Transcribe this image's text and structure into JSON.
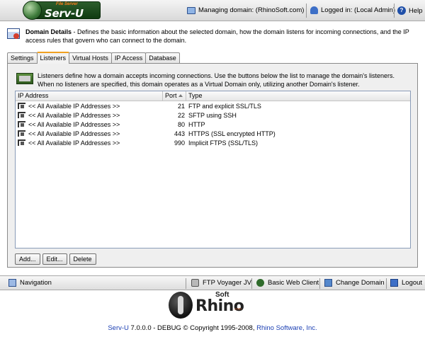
{
  "header": {
    "logo_text": "Serv-U",
    "logo_sub": "File Server",
    "managing_domain": "Managing domain: (RhinoSoft.com)",
    "logged_in": "Logged in: (Local Admin)",
    "help": "Help"
  },
  "description": {
    "title": "Domain Details",
    "text": " - Defines the basic information about the selected domain, how the domain listens for incoming connections, and the IP access rules that govern who can connect to the domain."
  },
  "tabs": [
    {
      "label": "Settings",
      "active": false
    },
    {
      "label": "Listeners",
      "active": true
    },
    {
      "label": "Virtual Hosts",
      "active": false
    },
    {
      "label": "IP Access",
      "active": false
    },
    {
      "label": "Database",
      "active": false
    }
  ],
  "panel": {
    "description": "Listeners define how a domain accepts incoming connections. Use the buttons below the list to manage the domain's listeners. When no listeners are specified, this domain operates as a Virtual Domain only, utilizing another Domain's listener."
  },
  "table": {
    "columns": [
      "IP Address",
      "Port",
      "Type"
    ],
    "rows": [
      {
        "ip": "<< All Available IP Addresses >>",
        "port": "21",
        "type": "FTP and explicit SSL/TLS"
      },
      {
        "ip": "<< All Available IP Addresses >>",
        "port": "22",
        "type": "SFTP using SSH"
      },
      {
        "ip": "<< All Available IP Addresses >>",
        "port": "80",
        "type": "HTTP"
      },
      {
        "ip": "<< All Available IP Addresses >>",
        "port": "443",
        "type": "HTTPS (SSL encrypted HTTP)"
      },
      {
        "ip": "<< All Available IP Addresses >>",
        "port": "990",
        "type": "Implicit FTPS (SSL/TLS)"
      }
    ]
  },
  "buttons": {
    "add": "Add...",
    "edit": "Edit...",
    "delete": "Delete"
  },
  "navbar": {
    "navigation": "Navigation",
    "ftp_voyager": "FTP Voyager JV",
    "basic_web_client": "Basic Web Client",
    "change_domain": "Change Domain",
    "logout": "Logout"
  },
  "footer": {
    "logo_text": "Rhino",
    "logo_soft": "Soft",
    "logo_com": ".com",
    "product": "Serv-U",
    "version_text": " 7.0.0.0 - DEBUG © Copyright 1995-2008, ",
    "company": "Rhino Software, Inc."
  },
  "colors": {
    "accent_tab": "#f0a020",
    "link": "#1b3fb3",
    "logo_green": "#2d5e2d"
  }
}
